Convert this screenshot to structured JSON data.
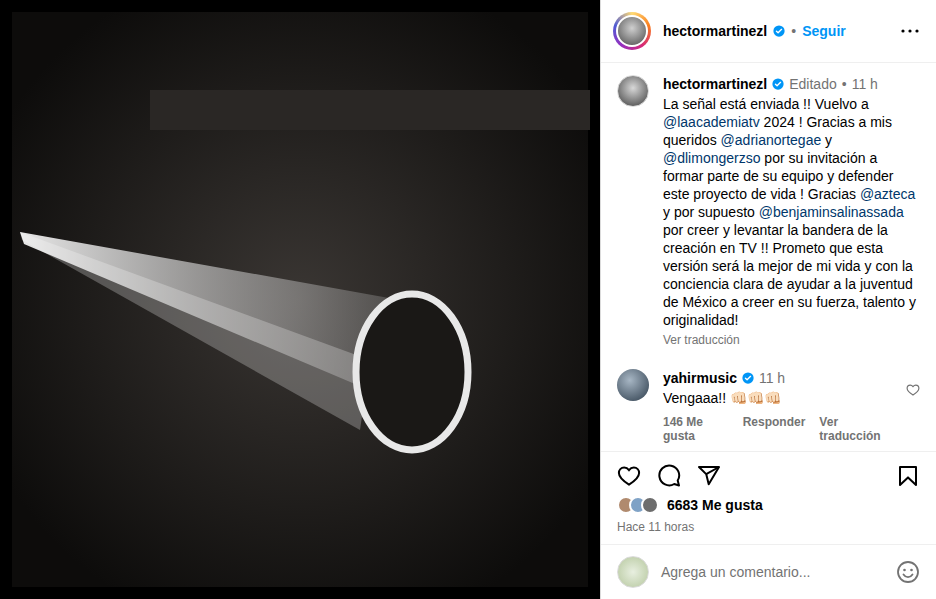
{
  "author": {
    "username": "hectormartinezl",
    "verified": true,
    "separator": "•",
    "follow_label": "Seguir"
  },
  "caption": {
    "username": "hectormartinezl",
    "verified": true,
    "edited": "Editado",
    "separator": "•",
    "time": "11 h",
    "segments": [
      {
        "kind": "text",
        "text": "La señal está enviada !! Vuelvo a "
      },
      {
        "kind": "mention",
        "text": "@laacademiatv"
      },
      {
        "kind": "text",
        "text": " 2024 ! Gracias a mis queridos "
      },
      {
        "kind": "mention",
        "text": "@adrianortegae"
      },
      {
        "kind": "text",
        "text": " y "
      },
      {
        "kind": "mention",
        "text": "@dlimongerzso"
      },
      {
        "kind": "text",
        "text": " por su invitación a formar parte de su equipo y defender este proyecto de vida ! Gracias "
      },
      {
        "kind": "mention",
        "text": "@azteca"
      },
      {
        "kind": "text",
        "text": " y por supuesto "
      },
      {
        "kind": "mention",
        "text": "@benjaminsalinassada"
      },
      {
        "kind": "text",
        "text": " por creer y levantar la bandera de la creación en TV !! Prometo que esta versión será la mejor de mi vida y con la conciencia clara de ayudar a la juventud de México a creer en su fuerza, talento y originalidad!"
      }
    ],
    "translate": "Ver traducción"
  },
  "comments": [
    {
      "username": "yahirmusic",
      "verified": true,
      "time": "11 h",
      "text": "Vengaaa!! 👊🏻👊🏻👊🏻",
      "likes": "146 Me gusta",
      "reply": "Responder",
      "translate": "Ver traducción",
      "liked": false
    }
  ],
  "actions": {
    "liked": false,
    "saved": false
  },
  "likes": {
    "count": "6683 Me gusta",
    "avatars": 3
  },
  "time": "Hace 11 horas",
  "comment_input": {
    "placeholder": "Agrega un comentario..."
  }
}
